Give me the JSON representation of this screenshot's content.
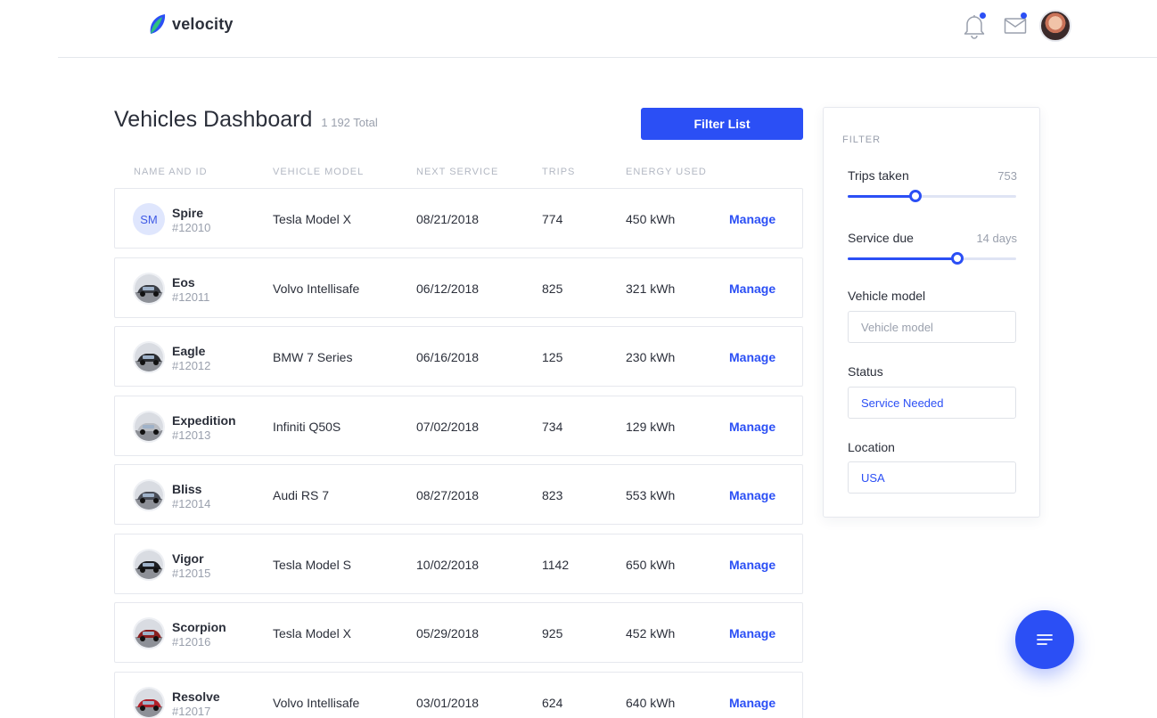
{
  "app": {
    "brand": "velocity",
    "brand_color": "#2b4ff5"
  },
  "header": {
    "icons": [
      "bell-icon",
      "mail-icon",
      "user-avatar"
    ],
    "notifications_unread": true,
    "messages_unread": true
  },
  "page": {
    "title": "Vehicles Dashboard",
    "total": "1 192 Total",
    "filter_button": "Filter List"
  },
  "table": {
    "columns": [
      "NAME AND ID",
      "VEHICLE MODEL",
      "NEXT SERVICE",
      "TRIPS",
      "ENERGY USED"
    ],
    "action_label": "Manage",
    "rows": [
      {
        "initials": "SM",
        "name": "Spire",
        "id": "#12010",
        "model": "Tesla Model X",
        "next_service": "08/21/2018",
        "trips": "774",
        "energy": "450 kWh",
        "car_color": ""
      },
      {
        "initials": "",
        "name": "Eos",
        "id": "#12011",
        "model": "Volvo Intellisafe",
        "next_service": "06/12/2018",
        "trips": "825",
        "energy": "321 kWh",
        "car_color": "#3a3d44"
      },
      {
        "initials": "",
        "name": "Eagle",
        "id": "#12012",
        "model": "BMW 7 Series",
        "next_service": "06/16/2018",
        "trips": "125",
        "energy": "230 kWh",
        "car_color": "#2a2c30"
      },
      {
        "initials": "",
        "name": "Expedition",
        "id": "#12013",
        "model": "Infiniti Q50S",
        "next_service": "07/02/2018",
        "trips": "734",
        "energy": "129 kWh",
        "car_color": "#b9bcc2"
      },
      {
        "initials": "",
        "name": "Bliss",
        "id": "#12014",
        "model": "Audi RS 7",
        "next_service": "08/27/2018",
        "trips": "823",
        "energy": "553 kWh",
        "car_color": "#4a4e58"
      },
      {
        "initials": "",
        "name": "Vigor",
        "id": "#12015",
        "model": "Tesla Model S",
        "next_service": "10/02/2018",
        "trips": "1142",
        "energy": "650 kWh",
        "car_color": "#1c1d21"
      },
      {
        "initials": "",
        "name": "Scorpion",
        "id": "#12016",
        "model": "Tesla Model X",
        "next_service": "05/29/2018",
        "trips": "925",
        "energy": "452 kWh",
        "car_color": "#8a1f1f"
      },
      {
        "initials": "",
        "name": "Resolve",
        "id": "#12017",
        "model": "Volvo Intellisafe",
        "next_service": "03/01/2018",
        "trips": "624",
        "energy": "640 kWh",
        "car_color": "#b0202a"
      }
    ]
  },
  "filter": {
    "heading": "FILTER",
    "trips_label": "Trips taken",
    "trips_value": "753",
    "trips_fraction": 0.4,
    "service_label": "Service due",
    "service_value": "14 days",
    "service_fraction": 0.65,
    "model_label": "Vehicle model",
    "model_placeholder": "Vehicle model",
    "model_value": "",
    "status_label": "Status",
    "status_value": "Service Needed",
    "location_label": "Location",
    "location_value": "USA"
  },
  "fab": {
    "icon": "menu-lines-icon"
  }
}
